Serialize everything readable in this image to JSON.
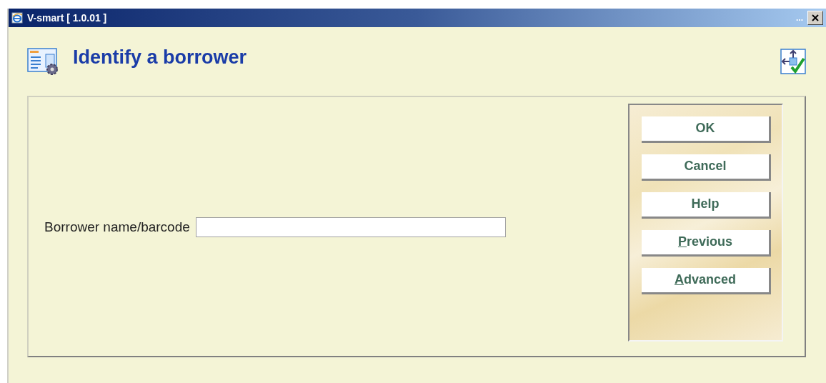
{
  "window": {
    "title": "V-smart [ 1.0.01 ]",
    "dots": "..."
  },
  "page": {
    "title": "Identify a borrower"
  },
  "form": {
    "label": "Borrower name/barcode"
  },
  "buttons": [
    {
      "label": "OK",
      "underline_first": false
    },
    {
      "label": "Cancel",
      "underline_first": false
    },
    {
      "label": "Help",
      "underline_first": false
    },
    {
      "label": "Previous",
      "underline_first": true
    },
    {
      "label": "Advanced",
      "underline_first": true
    }
  ]
}
